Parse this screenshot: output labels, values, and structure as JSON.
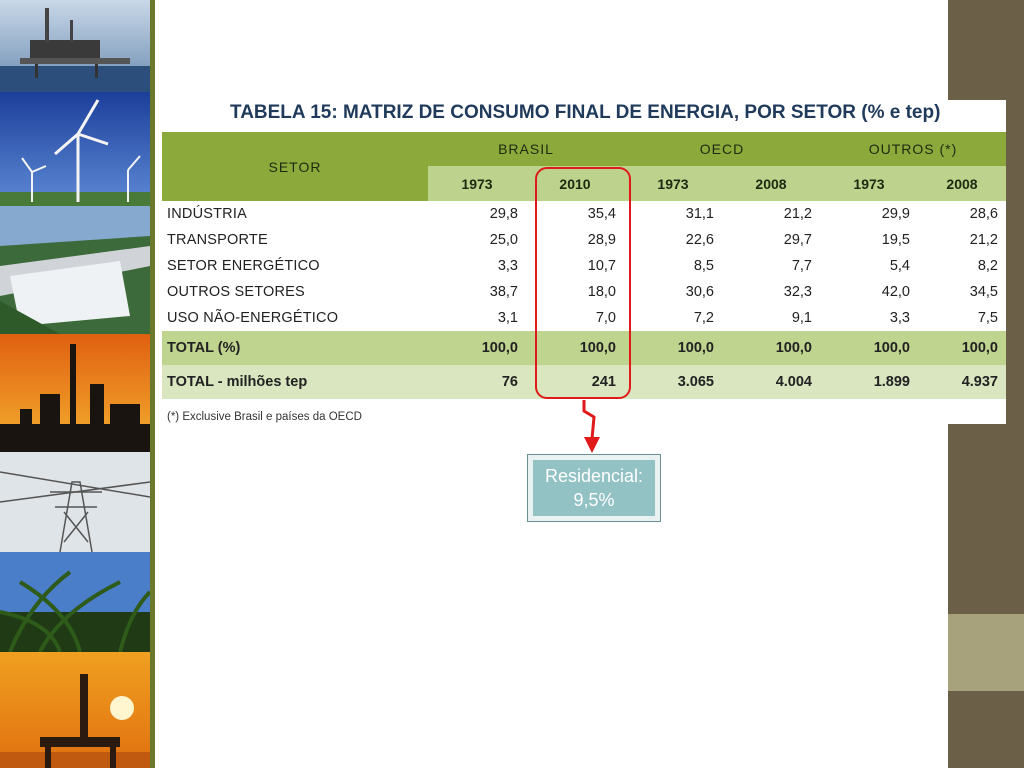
{
  "title": "TABELA 15: MATRIZ DE CONSUMO FINAL DE ENERGIA, POR SETOR (% e tep)",
  "table": {
    "setor_header": "SETOR",
    "groups": [
      "BRASIL",
      "OECD",
      "OUTROS (*)"
    ],
    "years": [
      "1973",
      "2010",
      "1973",
      "2008",
      "1973",
      "2008"
    ],
    "rows": [
      {
        "label": "INDÚSTRIA",
        "values": [
          "29,8",
          "35,4",
          "31,1",
          "21,2",
          "29,9",
          "28,6"
        ]
      },
      {
        "label": "TRANSPORTE",
        "values": [
          "25,0",
          "28,9",
          "22,6",
          "29,7",
          "19,5",
          "21,2"
        ]
      },
      {
        "label": "SETOR ENERGÉTICO",
        "values": [
          "3,3",
          "10,7",
          "8,5",
          "7,7",
          "5,4",
          "8,2"
        ]
      },
      {
        "label": "OUTROS SETORES",
        "values": [
          "38,7",
          "18,0",
          "30,6",
          "32,3",
          "42,0",
          "34,5"
        ]
      },
      {
        "label": "USO NÃO-ENERGÉTICO",
        "values": [
          "3,1",
          "7,0",
          "7,2",
          "9,1",
          "3,3",
          "7,5"
        ]
      }
    ],
    "total_pct": {
      "label": "TOTAL (%)",
      "values": [
        "100,0",
        "100,0",
        "100,0",
        "100,0",
        "100,0",
        "100,0"
      ]
    },
    "total_tep": {
      "label": "TOTAL - milhões tep",
      "values": [
        "76",
        "241",
        "3.065",
        "4.004",
        "1.899",
        "4.937"
      ]
    }
  },
  "footnote": "(*) Exclusive Brasil e países da OECD",
  "callout": {
    "line1": "Residencial:",
    "line2": "9,5%"
  },
  "colors": {
    "header_green": "#8caa3c",
    "subheader_green": "#bdd28c",
    "total_green": "#bfd48e",
    "total2_green": "#d9e6bf",
    "title_blue": "#1f3a5a",
    "highlight_red": "#e01a1a",
    "callout_teal": "#92c2c4",
    "right_bar": "#6b5f48",
    "right_bar_light": "#a8a27c"
  }
}
